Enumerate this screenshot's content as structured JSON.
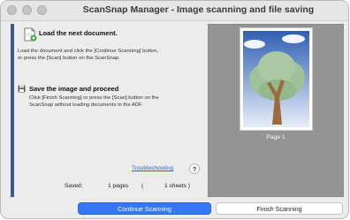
{
  "window": {
    "title": "ScanSnap Manager - Image scanning and file saving"
  },
  "step1": {
    "icon": "add-document-icon",
    "heading": "Load the next document.",
    "desc1": "Load the document and click the [Continue Scanning] button,",
    "desc2": "or press the [Scan] button on the ScanSnap."
  },
  "step2": {
    "icon": "save-disk-icon",
    "heading": "Save the image and proceed",
    "desc1": "Click [Finish Scanning] or press the [Scan] button on the",
    "desc2": "ScanSnap without loading documents in the ADF"
  },
  "help": {
    "link": "Troubleshooting",
    "icon_label": "?"
  },
  "saved": {
    "label": "Saved:",
    "pages": "1 pages",
    "open": "(",
    "sheets": "1 sheets )"
  },
  "preview": {
    "page_label": "Page 1"
  },
  "buttons": {
    "continue": "Continue Scanning",
    "finish": "Finish Scanning"
  },
  "colors": {
    "accent": "#3478f6",
    "sidebar_bar": "#3d5a8a",
    "link": "#2a5fc9"
  }
}
